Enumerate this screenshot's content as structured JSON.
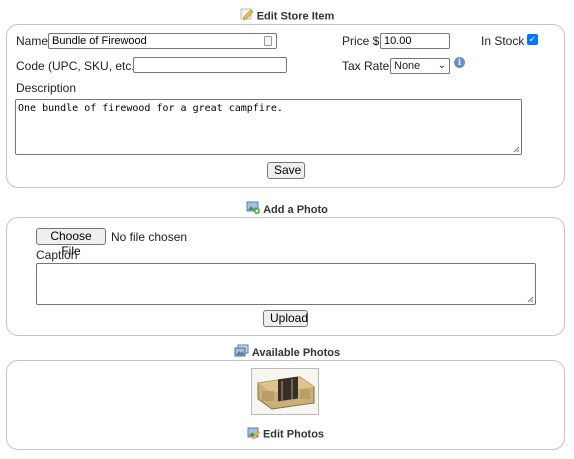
{
  "edit_item": {
    "title": "Edit Store Item",
    "name_label": "Name",
    "name_value": "Bundle of Firewood",
    "price_label": "Price $",
    "price_value": "10.00",
    "in_stock_label": "In Stock",
    "in_stock_checked": true,
    "code_label": "Code (UPC, SKU, etc.)",
    "code_value": "",
    "tax_rate_label": "Tax Rate",
    "tax_rate_value": "None",
    "description_label": "Description",
    "description_value": "One bundle of firewood for a great campfire.",
    "save_label": "Save"
  },
  "add_photo": {
    "title": "Add a Photo",
    "choose_file_label": "Choose File",
    "file_status": "No file chosen",
    "caption_label": "Caption",
    "caption_value": "",
    "upload_label": "Upload"
  },
  "available_photos": {
    "title": "Available Photos",
    "edit_photos_label": "Edit Photos"
  },
  "colors": {
    "accent": "#0075ff",
    "panel_border": "#c4c4c4"
  }
}
